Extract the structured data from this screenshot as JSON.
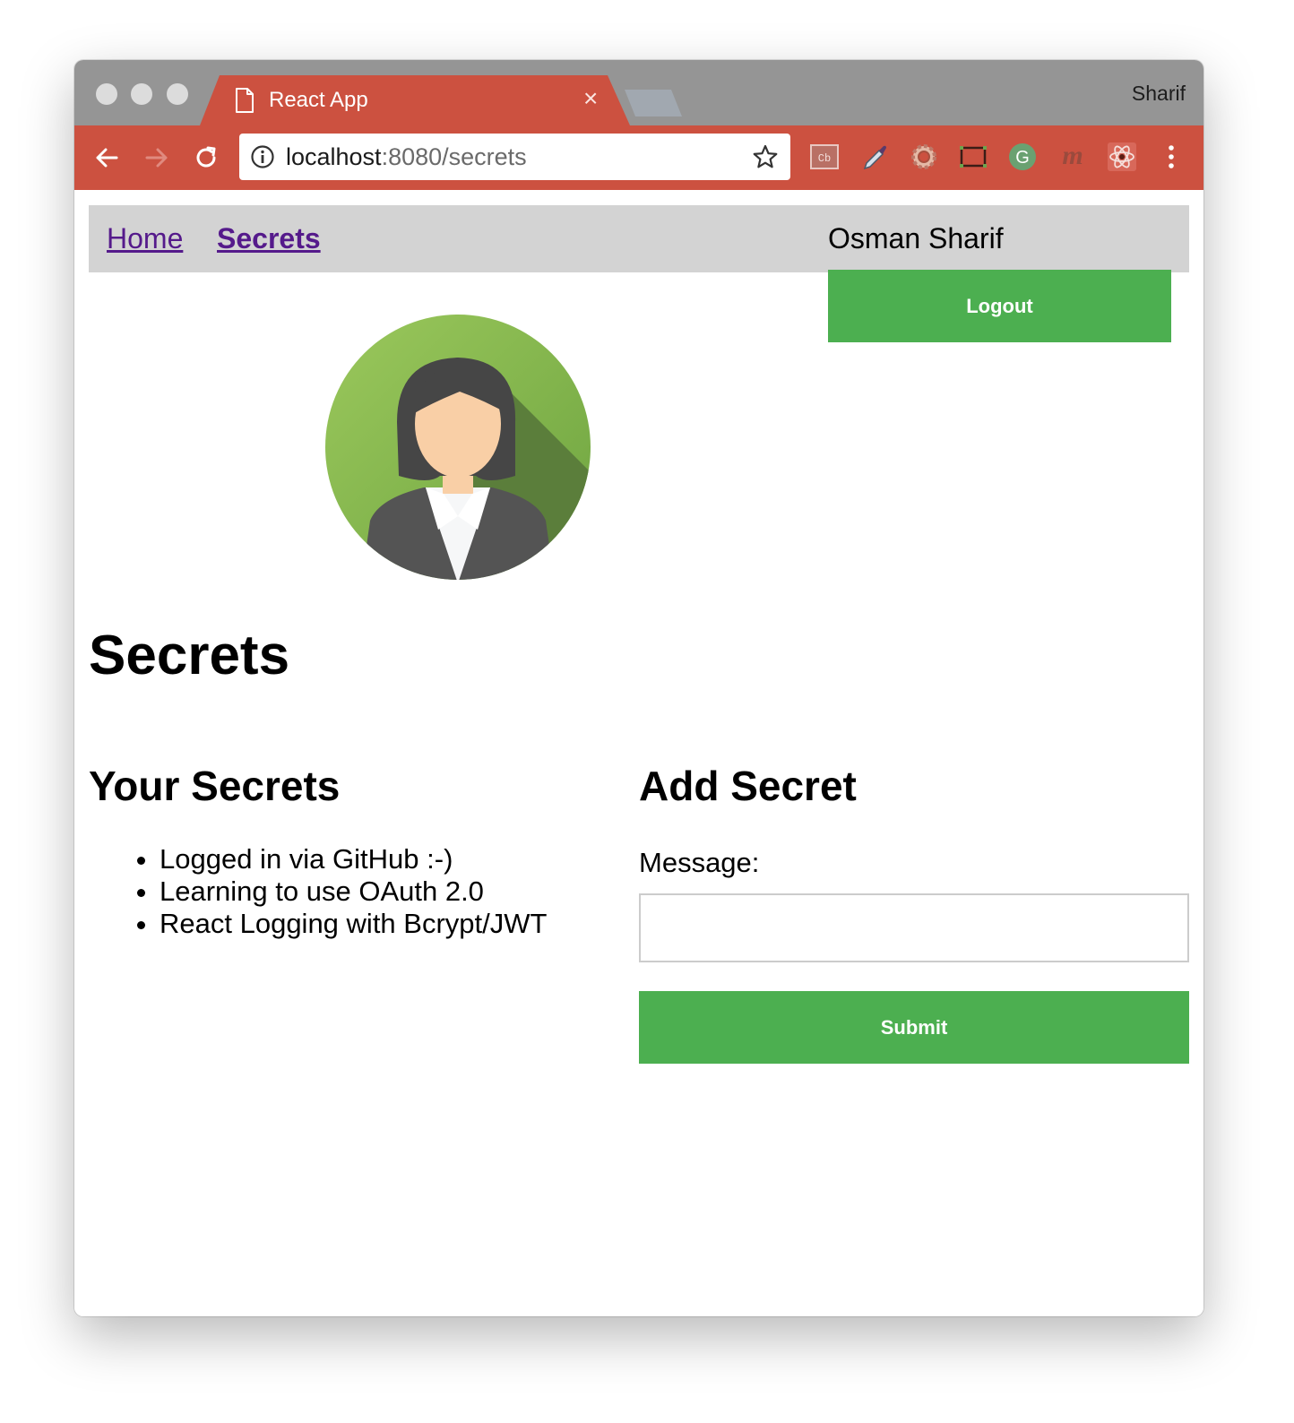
{
  "browser": {
    "tab_title": "React App",
    "tab_close_glyph": "×",
    "profile_name": "Sharif",
    "url_host": "localhost",
    "url_path": ":8080/secrets",
    "accent_color": "#cc5140",
    "extensions": [
      "colorzilla-cb-icon",
      "eyedropper-icon",
      "settings-gear-icon",
      "window-resize-icon",
      "grammarly-icon",
      "m-extension-icon",
      "react-devtools-icon",
      "more-menu-icon"
    ]
  },
  "nav": {
    "home": "Home",
    "secrets": "Secrets",
    "username": "Osman Sharif",
    "logout": "Logout"
  },
  "page": {
    "title": "Secrets",
    "your_secrets_heading": "Your Secrets",
    "secrets": [
      "Logged in via GitHub :-)",
      "Learning to use OAuth 2.0",
      "React Logging with Bcrypt/JWT"
    ],
    "add_secret_heading": "Add Secret",
    "message_label": "Message:",
    "message_value": "",
    "submit": "Submit",
    "button_color": "#4caf50"
  }
}
